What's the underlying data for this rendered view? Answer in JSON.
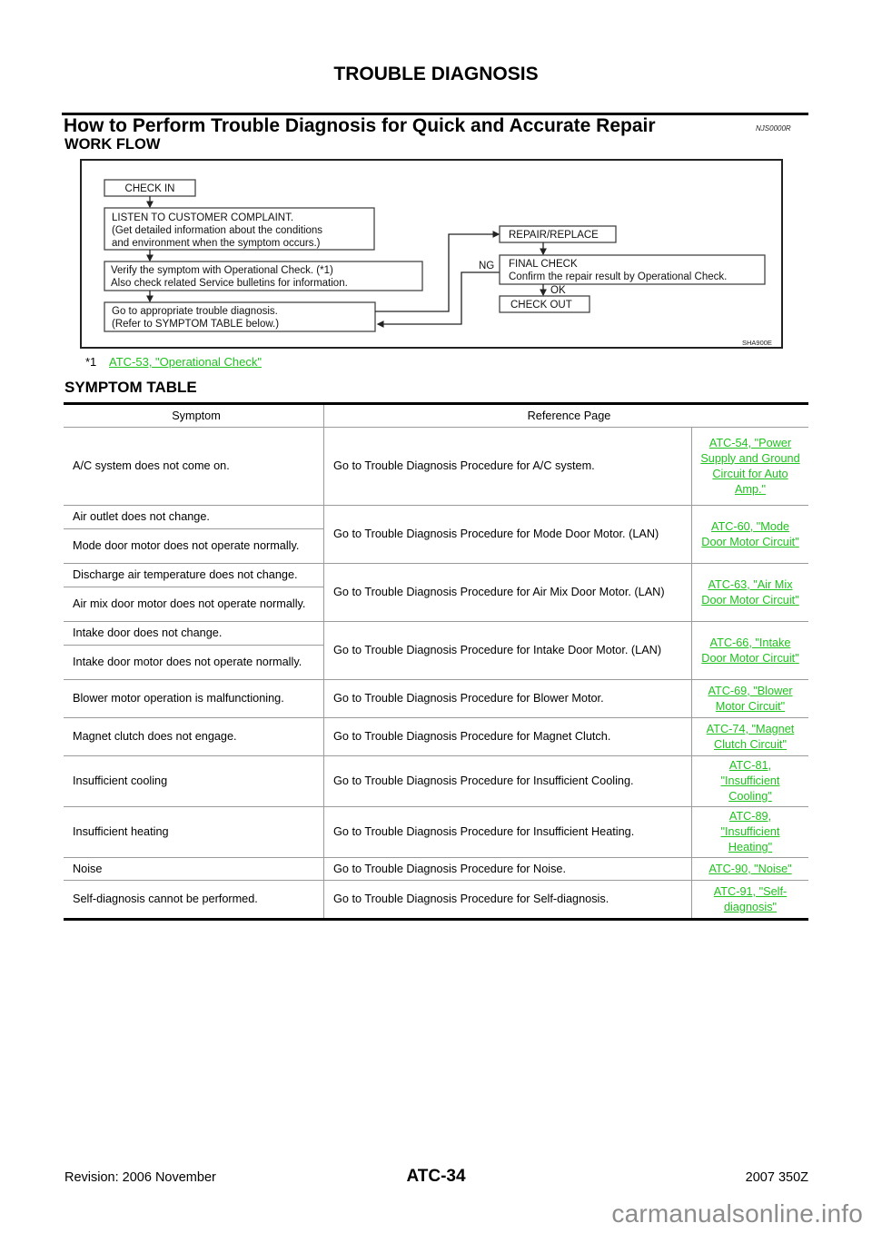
{
  "page": {
    "header": "TROUBLE DIAGNOSIS",
    "section_title": "How to Perform Trouble Diagnosis for Quick and Accurate Repair",
    "section_code": "NJS0000R",
    "workflow_title": "WORK FLOW",
    "symptom_table_title": "SYMPTOM TABLE"
  },
  "workflow": {
    "boxes": {
      "check_in": "CHECK IN",
      "listen_1": "LISTEN TO CUSTOMER COMPLAINT.",
      "listen_2": "(Get detailed information about the conditions",
      "listen_3": "and environment when the symptom occurs.)",
      "verify_1": "Verify the symptom with Operational Check. (*1)",
      "verify_2": "Also check related Service bulletins for information.",
      "goto_1": "Go to appropriate trouble diagnosis.",
      "goto_2": "(Refer to SYMPTOM TABLE below.)",
      "repair": "REPAIR/REPLACE",
      "final_1": "FINAL CHECK",
      "final_2": "Confirm the repair result by Operational Check.",
      "check_out": "CHECK OUT"
    },
    "labels": {
      "ng": "NG",
      "ok": "OK"
    },
    "figure_id": "SHA900E"
  },
  "footnote": {
    "mark": "*1",
    "link": "ATC-53, \"Operational Check\""
  },
  "symptom_table": {
    "headers": {
      "symptom": "Symptom",
      "reference": "Reference Page"
    },
    "groups": [
      {
        "symptoms": [
          "A/C system does not come on."
        ],
        "procedure": "Go to Trouble Diagnosis Procedure for A/C system.",
        "link": "ATC-54, \"Power Supply and Ground Circuit for Auto Amp.\""
      },
      {
        "symptoms": [
          "Air outlet does not change.",
          "Mode door motor does not operate normally."
        ],
        "procedure": "Go to Trouble Diagnosis Procedure for Mode Door Motor. (LAN)",
        "link": "ATC-60, \"Mode Door Motor Circuit\""
      },
      {
        "symptoms": [
          "Discharge air temperature does not change.",
          "Air mix door motor does not operate normally."
        ],
        "procedure": "Go to Trouble Diagnosis Procedure for Air Mix Door Motor. (LAN)",
        "link": "ATC-63, \"Air Mix Door Motor Circuit\""
      },
      {
        "symptoms": [
          "Intake door does not change.",
          "Intake door motor does not operate normally."
        ],
        "procedure": "Go to Trouble Diagnosis Procedure for Intake Door Motor. (LAN)",
        "link": "ATC-66, \"Intake Door Motor Circuit\""
      },
      {
        "symptoms": [
          "Blower motor operation is malfunctioning."
        ],
        "procedure": "Go to Trouble Diagnosis Procedure for Blower Motor.",
        "link": "ATC-69, \"Blower Motor Circuit\""
      },
      {
        "symptoms": [
          "Magnet clutch does not engage."
        ],
        "procedure": "Go to Trouble Diagnosis Procedure for Magnet Clutch.",
        "link": "ATC-74, \"Magnet Clutch Circuit\""
      },
      {
        "symptoms": [
          "Insufficient cooling"
        ],
        "procedure": "Go to Trouble Diagnosis Procedure for Insufficient Cooling.",
        "link": "ATC-81, \"Insufficient Cooling\""
      },
      {
        "symptoms": [
          "Insufficient heating"
        ],
        "procedure": "Go to Trouble Diagnosis Procedure for Insufficient Heating.",
        "link": "ATC-89, \"Insufficient Heating\""
      },
      {
        "symptoms": [
          "Noise"
        ],
        "procedure": "Go to Trouble Diagnosis Procedure for Noise.",
        "link": "ATC-90, \"Noise\""
      },
      {
        "symptoms": [
          "Self-diagnosis cannot be performed."
        ],
        "procedure": "Go to Trouble Diagnosis Procedure for Self-diagnosis.",
        "link": "ATC-91, \"Self-diagnosis\""
      }
    ]
  },
  "footer": {
    "revision": "Revision: 2006 November",
    "page_number": "ATC-34",
    "model": "2007 350Z",
    "watermark": "carmanualsonline.info"
  },
  "colors": {
    "link": "#1fc21f",
    "watermark": "#8c8c8c"
  }
}
